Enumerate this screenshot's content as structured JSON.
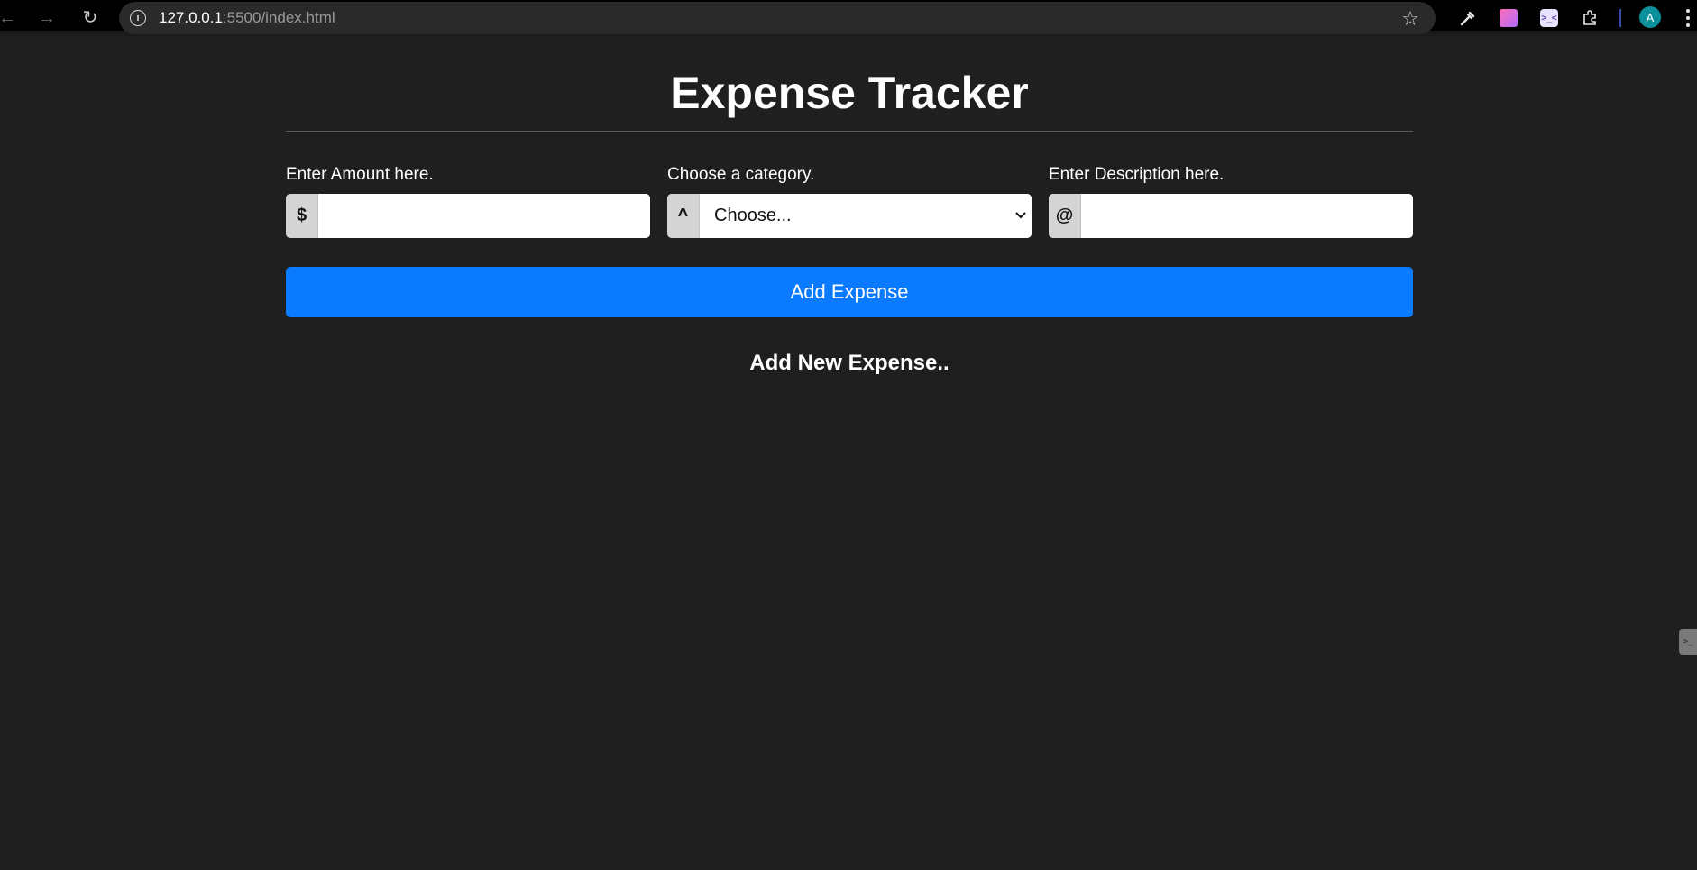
{
  "browser": {
    "back_icon": "arrow-left-icon",
    "forward_icon": "arrow-right-icon",
    "reload_icon": "reload-icon",
    "url_host": "127.0.0.1",
    "url_rest": ":5500/index.html",
    "avatar_letter": "A",
    "ext_face_text": ">_<"
  },
  "page": {
    "title": "Expense Tracker",
    "amount": {
      "label": "Enter Amount here.",
      "addon": "$",
      "value": ""
    },
    "category": {
      "label": "Choose a category.",
      "addon": "^",
      "selected": "Choose..."
    },
    "description": {
      "label": "Enter Description here.",
      "addon": "@",
      "value": ""
    },
    "add_button_label": "Add Expense",
    "section_heading": "Add New Expense.."
  },
  "colors": {
    "page_background": "#1f1f1f",
    "accent_button": "#0a7bff",
    "avatar": "#0b8f9a"
  }
}
